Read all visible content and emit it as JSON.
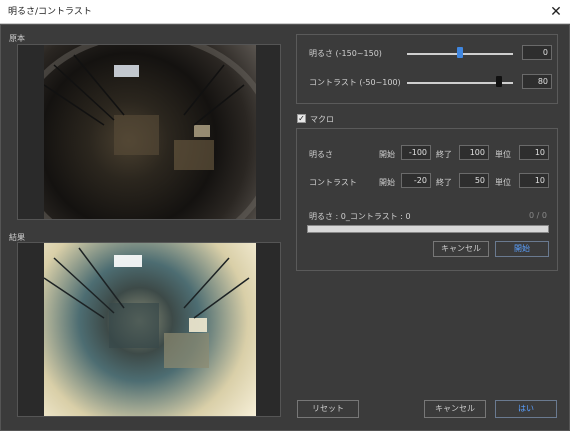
{
  "window": {
    "title": "明るさ/コントラスト",
    "close_glyph": "✕"
  },
  "left": {
    "original_label": "原本",
    "result_label": "結果"
  },
  "sliders": {
    "brightness": {
      "label": "明るさ (-150~150)",
      "value": "0",
      "min": -150,
      "max": 150,
      "thumb_color": "#3f86e0"
    },
    "contrast": {
      "label": "コントラスト (-50~100)",
      "value": "80",
      "min": -50,
      "max": 100,
      "thumb_color": "#111111"
    }
  },
  "macro": {
    "checkbox_label": "マクロ",
    "checked": true,
    "brightness_row": {
      "label": "明るさ",
      "start_label": "開始",
      "start": "-100",
      "end_label": "終了",
      "end": "100",
      "unit_label": "単位",
      "unit": "10"
    },
    "contrast_row": {
      "label": "コントラスト",
      "start_label": "開始",
      "start": "-20",
      "end_label": "終了",
      "end": "50",
      "unit_label": "単位",
      "unit": "10"
    },
    "status_text": "明るさ : 0_コントラスト : 0",
    "progress_text": "0 / 0",
    "progress_fraction": 0,
    "cancel_label": "キャンセル",
    "start_label": "開始"
  },
  "footer": {
    "reset_label": "リセット",
    "cancel_label": "キャンセル",
    "ok_label": "はい"
  }
}
